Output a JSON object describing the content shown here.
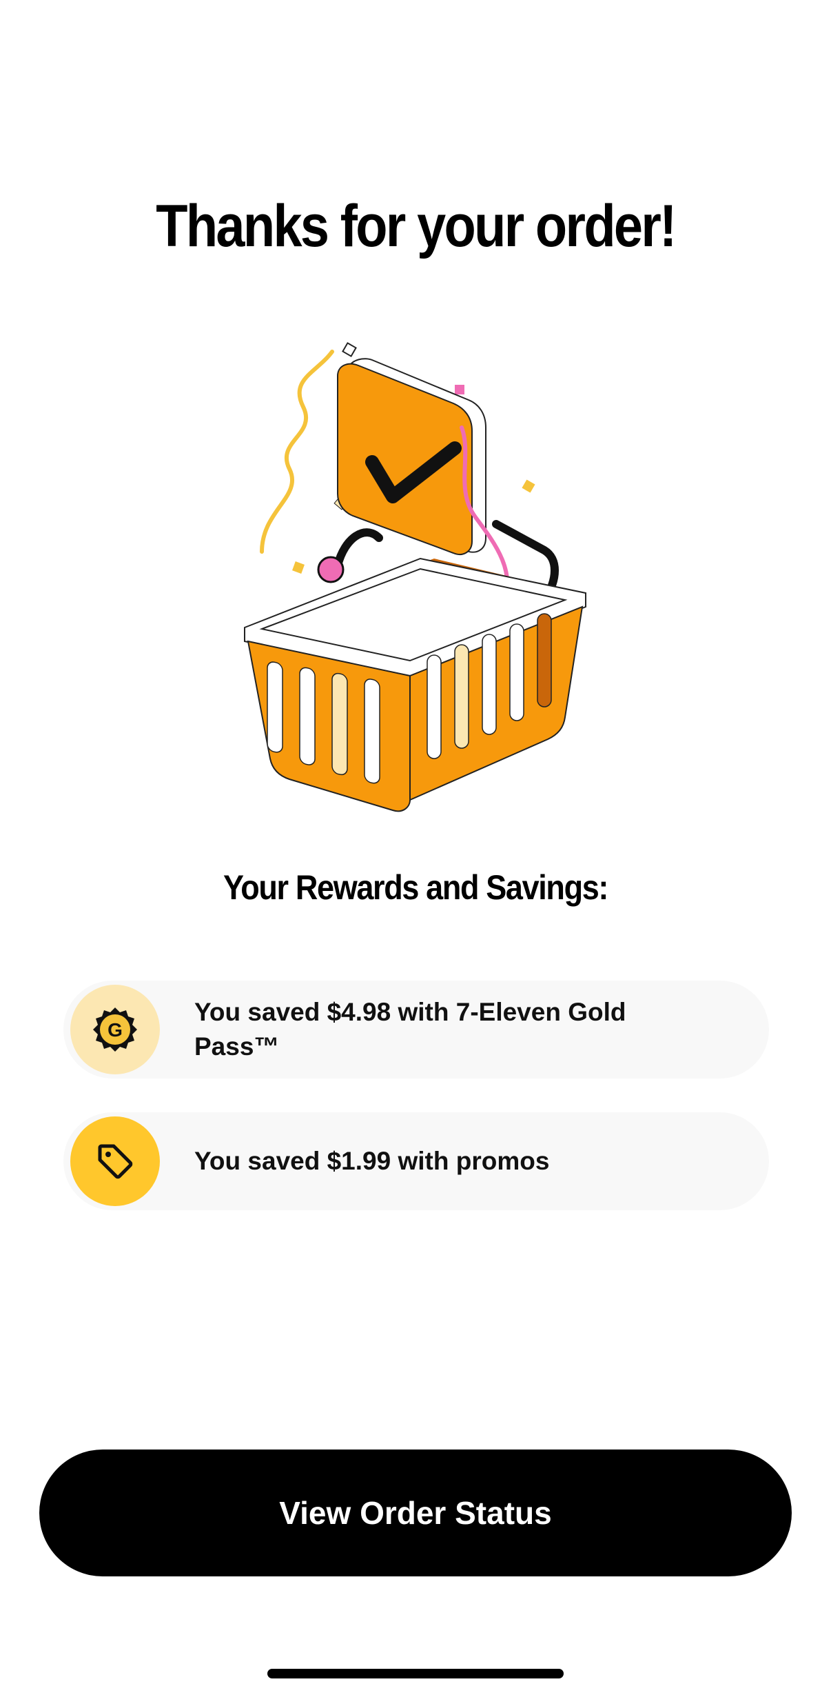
{
  "header": {
    "title": "Thanks for your order!"
  },
  "illustration": {
    "icon": "basket-checkmark-illustration"
  },
  "rewards": {
    "heading": "Your Rewards and Savings:",
    "items": [
      {
        "icon": "gold-pass-badge-icon",
        "text": "You saved $4.98 with 7-Eleven Gold Pass™",
        "badge_color": "#fce7b2"
      },
      {
        "icon": "tag-icon",
        "text": "You saved $1.99 with promos",
        "badge_color": "#ffc72c"
      }
    ]
  },
  "actions": {
    "view_order_status": "View Order Status"
  },
  "colors": {
    "brand_orange": "#f7990c",
    "accent_pink": "#ef6cb4",
    "accent_yellow": "#f5c33b",
    "card_bg": "#f8f8f8",
    "button_bg": "#000000"
  }
}
